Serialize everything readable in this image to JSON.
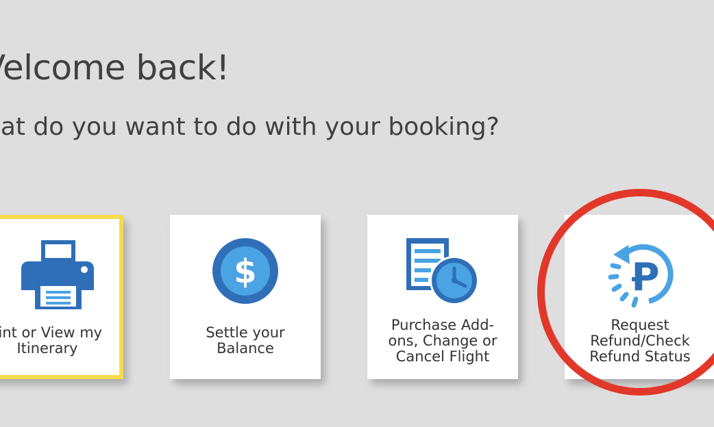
{
  "header": {
    "welcome": "Velcome back!",
    "question": "hat do you want to do with your booking?"
  },
  "options": [
    {
      "label": "rint or View my\nItinerary",
      "icon": "printer-icon",
      "selected": true
    },
    {
      "label": "Settle your\nBalance",
      "icon": "dollar-coin-icon",
      "selected": false
    },
    {
      "label": "Purchase Add-\nons, Change or\nCancel Flight",
      "icon": "document-clock-icon",
      "selected": false
    },
    {
      "label": "Request\nRefund/Check\nRefund Status",
      "icon": "refund-p-icon",
      "selected": false
    }
  ],
  "colors": {
    "background": "#dedede",
    "card": "#ffffff",
    "selected_border": "#f4dc4a",
    "icon_dark_blue": "#2f6fb8",
    "icon_light_blue": "#4aa3e3",
    "annotation_red": "#e2382a",
    "heading_text": "#404040"
  }
}
